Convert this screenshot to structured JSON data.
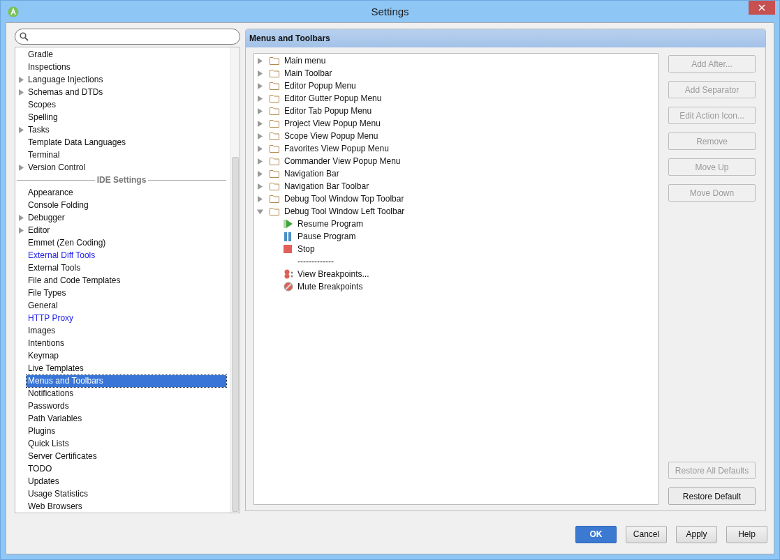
{
  "window": {
    "title": "Settings"
  },
  "settings_list": [
    {
      "items": [
        {
          "label": "Gradle",
          "expandable": false,
          "kind": "plain",
          "selected": false
        },
        {
          "label": "Inspections",
          "expandable": false,
          "kind": "plain",
          "selected": false
        },
        {
          "label": "Language Injections",
          "expandable": true,
          "kind": "plain",
          "selected": false
        },
        {
          "label": "Schemas and DTDs",
          "expandable": true,
          "kind": "plain",
          "selected": false
        },
        {
          "label": "Scopes",
          "expandable": false,
          "kind": "plain",
          "selected": false
        },
        {
          "label": "Spelling",
          "expandable": false,
          "kind": "plain",
          "selected": false
        },
        {
          "label": "Tasks",
          "expandable": true,
          "kind": "plain",
          "selected": false
        },
        {
          "label": "Template Data Languages",
          "expandable": false,
          "kind": "plain",
          "selected": false
        },
        {
          "label": "Terminal",
          "expandable": false,
          "kind": "plain",
          "selected": false
        },
        {
          "label": "Version Control",
          "expandable": true,
          "kind": "plain",
          "selected": false
        }
      ]
    },
    {
      "header": "IDE Settings",
      "items": [
        {
          "label": "Appearance",
          "expandable": false,
          "kind": "plain",
          "selected": false
        },
        {
          "label": "Console Folding",
          "expandable": false,
          "kind": "plain",
          "selected": false
        },
        {
          "label": "Debugger",
          "expandable": true,
          "kind": "plain",
          "selected": false
        },
        {
          "label": "Editor",
          "expandable": true,
          "kind": "plain",
          "selected": false
        },
        {
          "label": "Emmet (Zen Coding)",
          "expandable": false,
          "kind": "plain",
          "selected": false
        },
        {
          "label": "External Diff Tools",
          "expandable": false,
          "kind": "link",
          "selected": false
        },
        {
          "label": "External Tools",
          "expandable": false,
          "kind": "plain",
          "selected": false
        },
        {
          "label": "File and Code Templates",
          "expandable": false,
          "kind": "plain",
          "selected": false
        },
        {
          "label": "File Types",
          "expandable": false,
          "kind": "plain",
          "selected": false
        },
        {
          "label": "General",
          "expandable": false,
          "kind": "plain",
          "selected": false
        },
        {
          "label": "HTTP Proxy",
          "expandable": false,
          "kind": "link",
          "selected": false
        },
        {
          "label": "Images",
          "expandable": false,
          "kind": "plain",
          "selected": false
        },
        {
          "label": "Intentions",
          "expandable": false,
          "kind": "plain",
          "selected": false
        },
        {
          "label": "Keymap",
          "expandable": false,
          "kind": "plain",
          "selected": false
        },
        {
          "label": "Live Templates",
          "expandable": false,
          "kind": "plain",
          "selected": false
        },
        {
          "label": "Menus and Toolbars",
          "expandable": false,
          "kind": "plain",
          "selected": true
        },
        {
          "label": "Notifications",
          "expandable": false,
          "kind": "plain",
          "selected": false
        },
        {
          "label": "Passwords",
          "expandable": false,
          "kind": "plain",
          "selected": false
        },
        {
          "label": "Path Variables",
          "expandable": false,
          "kind": "plain",
          "selected": false
        },
        {
          "label": "Plugins",
          "expandable": false,
          "kind": "plain",
          "selected": false
        },
        {
          "label": "Quick Lists",
          "expandable": false,
          "kind": "plain",
          "selected": false
        },
        {
          "label": "Server Certificates",
          "expandable": false,
          "kind": "plain",
          "selected": false
        },
        {
          "label": "TODO",
          "expandable": false,
          "kind": "plain",
          "selected": false
        },
        {
          "label": "Updates",
          "expandable": false,
          "kind": "plain",
          "selected": false
        },
        {
          "label": "Usage Statistics",
          "expandable": false,
          "kind": "plain",
          "selected": false
        },
        {
          "label": "Web Browsers",
          "expandable": false,
          "kind": "plain",
          "selected": false
        }
      ]
    }
  ],
  "panel": {
    "title": "Menus and Toolbars",
    "tree": [
      {
        "label": "Main menu",
        "expanded": false
      },
      {
        "label": "Main Toolbar",
        "expanded": false
      },
      {
        "label": "Editor Popup Menu",
        "expanded": false
      },
      {
        "label": "Editor Gutter Popup Menu",
        "expanded": false
      },
      {
        "label": "Editor Tab Popup Menu",
        "expanded": false
      },
      {
        "label": "Project View Popup Menu",
        "expanded": false
      },
      {
        "label": "Scope View Popup Menu",
        "expanded": false
      },
      {
        "label": "Favorites View Popup Menu",
        "expanded": false
      },
      {
        "label": "Commander View Popup Menu",
        "expanded": false
      },
      {
        "label": "Navigation Bar",
        "expanded": false
      },
      {
        "label": "Navigation Bar Toolbar",
        "expanded": false
      },
      {
        "label": "Debug Tool Window Top Toolbar",
        "expanded": false
      },
      {
        "label": "Debug Tool Window Left Toolbar",
        "expanded": true,
        "children": [
          {
            "label": "Resume Program",
            "kind": "resume"
          },
          {
            "label": "Pause Program",
            "kind": "pause"
          },
          {
            "label": "Stop",
            "kind": "stop"
          },
          {
            "label": "-------------",
            "kind": "separator"
          },
          {
            "label": "View Breakpoints...",
            "kind": "breakpoints"
          },
          {
            "label": "Mute Breakpoints",
            "kind": "mute"
          }
        ]
      }
    ],
    "actions": [
      {
        "label": "Add After...",
        "disabled": true
      },
      {
        "label": "Add Separator",
        "disabled": true
      },
      {
        "label": "Edit Action Icon...",
        "disabled": true
      },
      {
        "label": "Remove",
        "disabled": true
      },
      {
        "label": "Move Up",
        "disabled": true
      },
      {
        "label": "Move Down",
        "disabled": true
      }
    ],
    "restore_actions": [
      {
        "label": "Restore All Defaults",
        "disabled": true
      },
      {
        "label": "Restore Default",
        "disabled": false
      }
    ]
  },
  "dialog_buttons": [
    {
      "label": "OK",
      "kind": "primary"
    },
    {
      "label": "Cancel",
      "kind": "normal"
    },
    {
      "label": "Apply",
      "kind": "normal"
    },
    {
      "label": "Help",
      "kind": "normal"
    }
  ]
}
